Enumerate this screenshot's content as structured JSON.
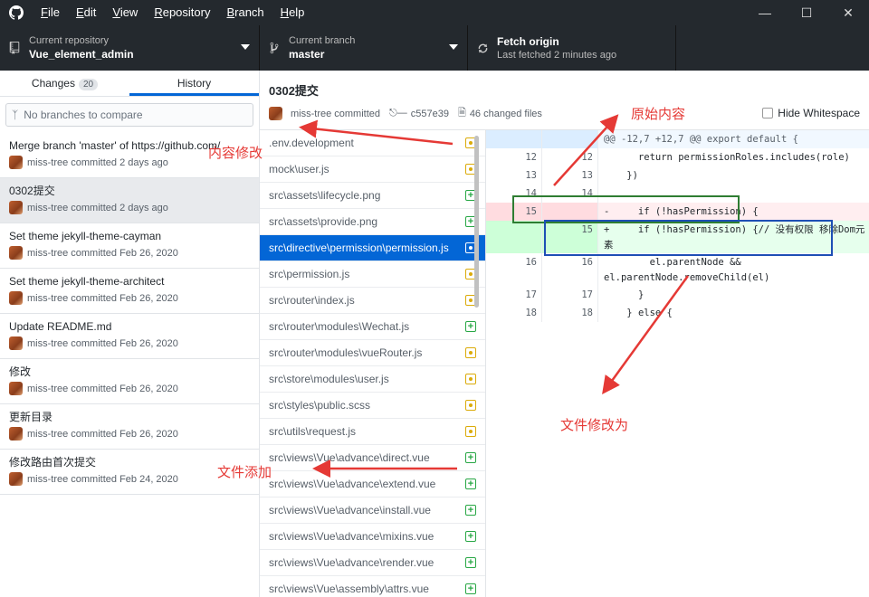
{
  "menu": [
    "File",
    "Edit",
    "View",
    "Repository",
    "Branch",
    "Help"
  ],
  "toolbar": {
    "repo_label": "Current repository",
    "repo_value": "Vue_element_admin",
    "branch_label": "Current branch",
    "branch_value": "master",
    "fetch_label": "Fetch origin",
    "fetch_sub": "Last fetched 2 minutes ago"
  },
  "tabs": {
    "changes": "Changes",
    "changes_count": "20",
    "history": "History"
  },
  "compare_placeholder": "No branches to compare",
  "commits": [
    {
      "title": "Merge branch 'master' of https://github.com/",
      "meta": "miss-tree committed 2 days ago"
    },
    {
      "title": "0302提交",
      "meta": "miss-tree committed 2 days ago"
    },
    {
      "title": "Set theme jekyll-theme-cayman",
      "meta": "miss-tree committed Feb 26, 2020"
    },
    {
      "title": "Set theme jekyll-theme-architect",
      "meta": "miss-tree committed Feb 26, 2020"
    },
    {
      "title": "Update README.md",
      "meta": "miss-tree committed Feb 26, 2020"
    },
    {
      "title": "修改",
      "meta": "miss-tree committed Feb 26, 2020"
    },
    {
      "title": "更新目录",
      "meta": "miss-tree committed Feb 26, 2020"
    },
    {
      "title": "修改路由首次提交",
      "meta": "miss-tree committed Feb 24, 2020"
    }
  ],
  "header": {
    "title": "0302提交",
    "author": "miss-tree committed",
    "sha": "c557e39",
    "files_changed": "46 changed files",
    "hide_whitespace": "Hide Whitespace"
  },
  "files": [
    {
      "name": ".env.development",
      "status": "modified"
    },
    {
      "name": "mock\\user.js",
      "status": "modified"
    },
    {
      "name": "src\\assets\\lifecycle.png",
      "status": "added"
    },
    {
      "name": "src\\assets\\provide.png",
      "status": "added"
    },
    {
      "name": "src\\directive\\permission\\permission.js",
      "status": "modified",
      "selected": true
    },
    {
      "name": "src\\permission.js",
      "status": "modified"
    },
    {
      "name": "src\\router\\index.js",
      "status": "modified"
    },
    {
      "name": "src\\router\\modules\\Wechat.js",
      "status": "added"
    },
    {
      "name": "src\\router\\modules\\vueRouter.js",
      "status": "modified"
    },
    {
      "name": "src\\store\\modules\\user.js",
      "status": "modified"
    },
    {
      "name": "src\\styles\\public.scss",
      "status": "modified"
    },
    {
      "name": "src\\utils\\request.js",
      "status": "modified"
    },
    {
      "name": "src\\views\\Vue\\advance\\direct.vue",
      "status": "added"
    },
    {
      "name": "src\\views\\Vue\\advance\\extend.vue",
      "status": "added"
    },
    {
      "name": "src\\views\\Vue\\advance\\install.vue",
      "status": "added"
    },
    {
      "name": "src\\views\\Vue\\advance\\mixins.vue",
      "status": "added"
    },
    {
      "name": "src\\views\\Vue\\advance\\render.vue",
      "status": "added"
    },
    {
      "name": "src\\views\\Vue\\assembly\\attrs.vue",
      "status": "added"
    }
  ],
  "diff": {
    "hunk": "@@ -12,7 +12,7 @@ export default {",
    "lines": [
      {
        "old": "12",
        "new": "12",
        "type": "ctx",
        "code": "      return permissionRoles.includes(role)"
      },
      {
        "old": "13",
        "new": "13",
        "type": "ctx",
        "code": "    })"
      },
      {
        "old": "14",
        "new": "14",
        "type": "ctx",
        "code": ""
      },
      {
        "old": "15",
        "new": "",
        "type": "del",
        "code": "-     if (!hasPermission) {"
      },
      {
        "old": "",
        "new": "15",
        "type": "ins",
        "code": "+     if (!hasPermission) {// 没有权限 移除Dom元素"
      },
      {
        "old": "16",
        "new": "16",
        "type": "ctx",
        "code": "        el.parentNode && el.parentNode.removeChild(el)"
      },
      {
        "old": "17",
        "new": "17",
        "type": "ctx",
        "code": "      }"
      },
      {
        "old": "18",
        "new": "18",
        "type": "ctx",
        "code": "    } else {"
      }
    ]
  },
  "annotations": {
    "original": "原始内容",
    "content_modified": "内容修改",
    "file_modified_to": "文件修改为",
    "file_added": "文件添加"
  },
  "colors": {
    "accent": "#0366d6",
    "annotation": "#e53935",
    "modified": "#dbab09",
    "added": "#28a745"
  }
}
